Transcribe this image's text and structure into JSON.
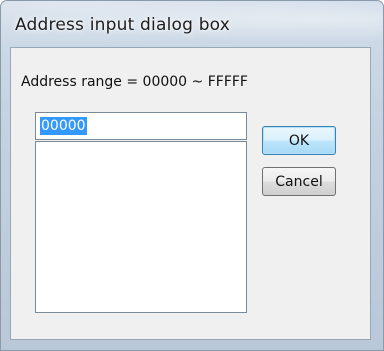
{
  "window": {
    "title": "Address input dialog box"
  },
  "dialog": {
    "range_label": "Address range = 00000 ~ FFFFF",
    "address_input": {
      "value": "00000",
      "selected": true
    },
    "address_list": {
      "items": []
    },
    "buttons": {
      "ok_label": "OK",
      "cancel_label": "Cancel"
    }
  },
  "colors": {
    "selection_highlight": "#3399ff",
    "default_button_border": "#3c7fb1"
  }
}
